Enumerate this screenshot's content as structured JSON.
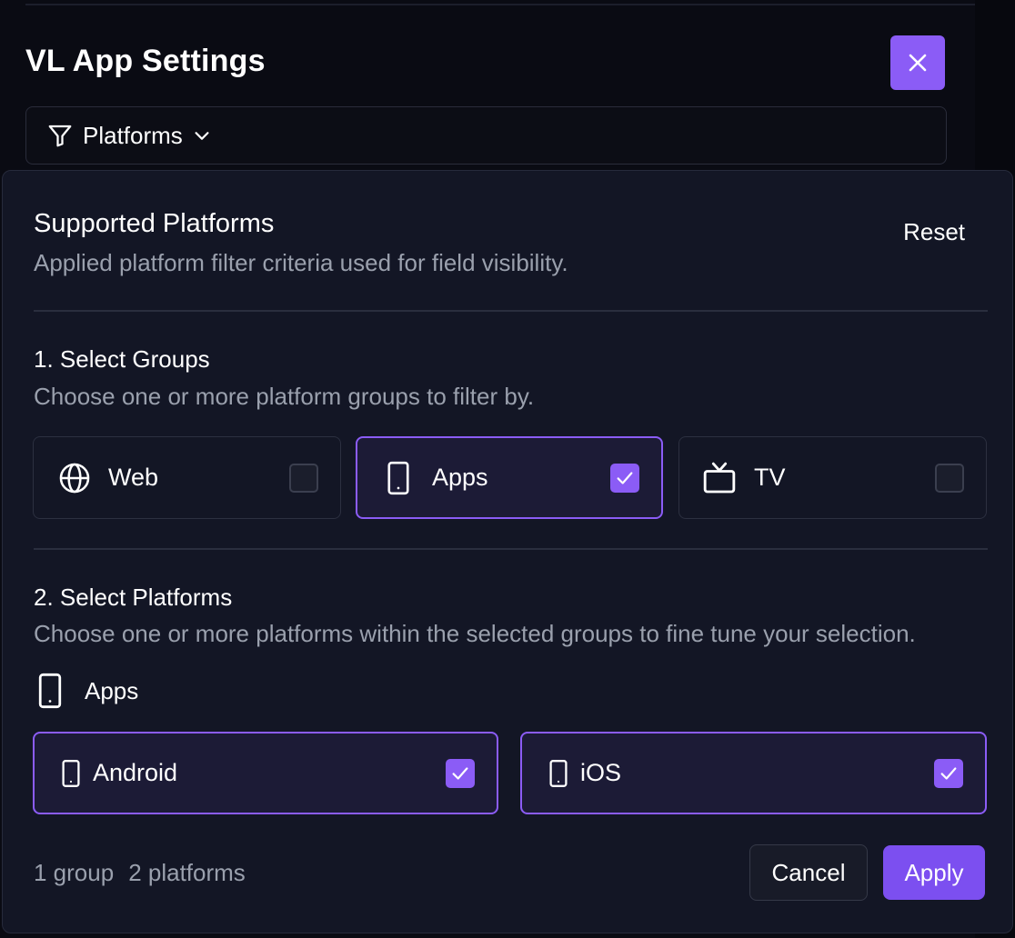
{
  "header": {
    "title": "VL App Settings",
    "close_icon": "close-icon"
  },
  "filter_bar": {
    "icon": "filter-icon",
    "label": "Platforms",
    "chevron_icon": "chevron-down-icon"
  },
  "panel": {
    "title": "Supported Platforms",
    "subtitle": "Applied platform filter criteria used for field visibility.",
    "reset_label": "Reset"
  },
  "groups_section": {
    "title": "1. Select Groups",
    "subtitle": "Choose one or more platform groups to filter by.",
    "items": [
      {
        "label": "Web",
        "icon": "globe-icon",
        "checked": false
      },
      {
        "label": "Apps",
        "icon": "mobile-device-icon",
        "checked": true
      },
      {
        "label": "TV",
        "icon": "tv-icon",
        "checked": false
      }
    ]
  },
  "platforms_section": {
    "title": "2. Select Platforms",
    "subtitle": "Choose one or more platforms within the selected groups to fine tune your selection.",
    "group_heading": "Apps",
    "items": [
      {
        "label": "Android",
        "icon": "mobile-device-icon",
        "checked": true
      },
      {
        "label": "iOS",
        "icon": "mobile-device-icon",
        "checked": true
      }
    ]
  },
  "footer": {
    "group_count": "1 group",
    "platform_count": "2 platforms",
    "cancel_label": "Cancel",
    "apply_label": "Apply"
  },
  "colors": {
    "accent": "#8b5cf6",
    "background": "#0a0b13",
    "panel": "#131625",
    "muted_text": "#9aa0ad"
  }
}
